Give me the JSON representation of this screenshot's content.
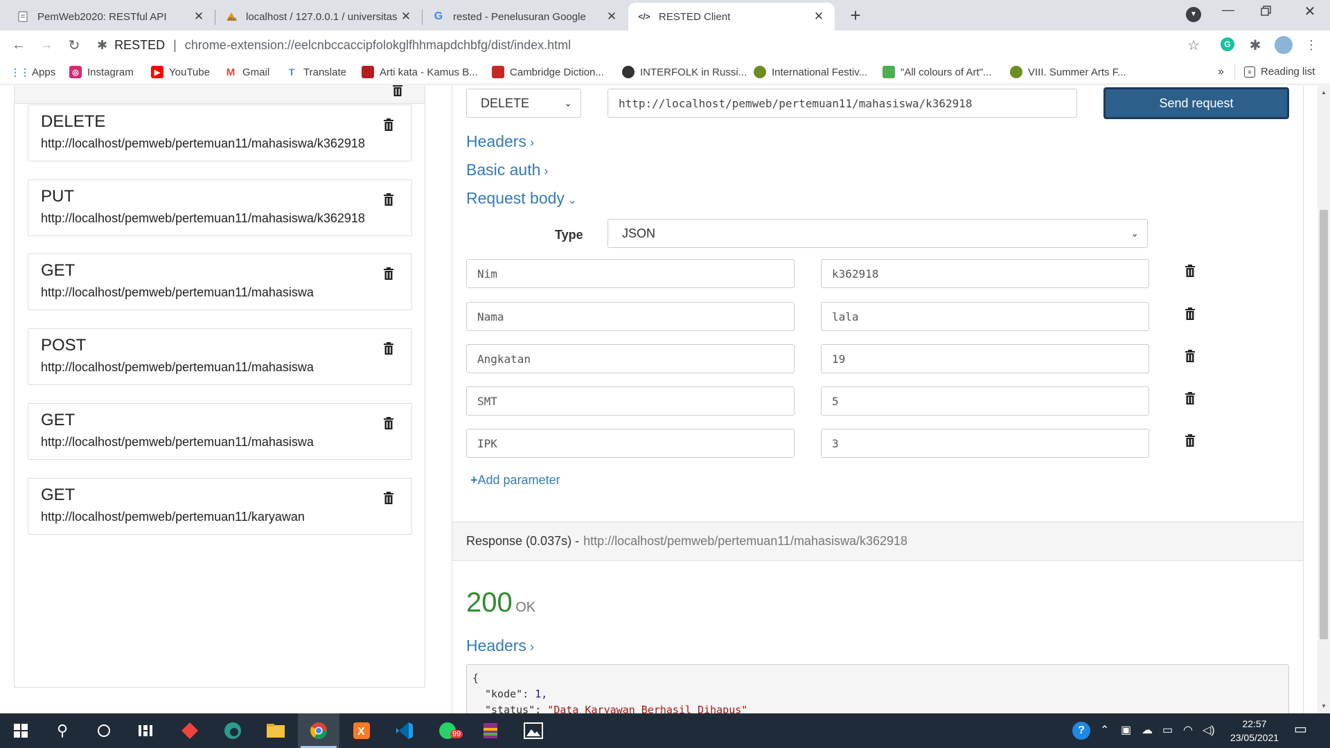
{
  "browser": {
    "tabs": [
      {
        "title": "PemWeb2020: RESTful API",
        "icon": "doc-icon"
      },
      {
        "title": "localhost / 127.0.0.1 / universitas",
        "icon": "phpmyadmin-icon"
      },
      {
        "title": "rested - Penelusuran Google",
        "icon": "google-icon"
      },
      {
        "title": "RESTED Client",
        "icon": "code-icon"
      }
    ],
    "new_tab": "+",
    "site_name": "RESTED",
    "address": "chrome-extension://eelcnbccaccipfolokglfhhmapdchbfg/dist/index.html",
    "bookmarks": [
      {
        "label": "Apps",
        "color": "#4285f4"
      },
      {
        "label": "Instagram",
        "color": "#d62976"
      },
      {
        "label": "YouTube",
        "color": "#ff0000"
      },
      {
        "label": "Gmail",
        "color": "#ea4335"
      },
      {
        "label": "Translate",
        "color": "#4285f4"
      },
      {
        "label": "Arti kata - Kamus B...",
        "color": "#b71c1c"
      },
      {
        "label": "Cambridge Diction...",
        "color": "#c62828"
      },
      {
        "label": "INTERFOLK in Russi...",
        "color": "#333333"
      },
      {
        "label": "International Festiv...",
        "color": "#6b8e23"
      },
      {
        "label": "\"All colours of Art\"...",
        "color": "#4caf50"
      },
      {
        "label": "VIII. Summer Arts F...",
        "color": "#6b8e23"
      }
    ],
    "more_bookmarks": "»",
    "reading_list": "Reading list"
  },
  "history": [
    {
      "method": "DELETE",
      "url": "http://localhost/pemweb/pertemuan11/mahasiswa/k362918"
    },
    {
      "method": "PUT",
      "url": "http://localhost/pemweb/pertemuan11/mahasiswa/k362918"
    },
    {
      "method": "GET",
      "url": "http://localhost/pemweb/pertemuan11/mahasiswa"
    },
    {
      "method": "POST",
      "url": "http://localhost/pemweb/pertemuan11/mahasiswa"
    },
    {
      "method": "GET",
      "url": "http://localhost/pemweb/pertemuan11/mahasiswa"
    },
    {
      "method": "GET",
      "url": "http://localhost/pemweb/pertemuan11/karyawan"
    }
  ],
  "request": {
    "method": "DELETE",
    "url": "http://localhost/pemweb/pertemuan11/mahasiswa/k362918",
    "send_label": "Send request",
    "headers_label": "Headers",
    "basic_auth_label": "Basic auth",
    "request_body_label": "Request body",
    "type_label": "Type",
    "type_value": "JSON",
    "params": [
      {
        "key": "Nim",
        "value": "k362918"
      },
      {
        "key": "Nama",
        "value": "lala"
      },
      {
        "key": "Angkatan",
        "value": "19"
      },
      {
        "key": "SMT",
        "value": "5"
      },
      {
        "key": "IPK",
        "value": "3"
      }
    ],
    "add_param_label": "Add parameter"
  },
  "response": {
    "title": "Response (0.037s) -",
    "url": "http://localhost/pemweb/pertemuan11/mahasiswa/k362918",
    "status_code": "200",
    "status_text": "OK",
    "headers_label": "Headers",
    "body_lines": [
      {
        "text": "{",
        "key": "",
        "sep": "",
        "val": ""
      },
      {
        "text": "",
        "key": "\"kode\"",
        "sep": ": ",
        "val": "1,"
      },
      {
        "text": "",
        "key": "\"status\"",
        "sep": ": ",
        "val": "\"Data Karyawan Berhasil Dihapus\""
      }
    ]
  },
  "taskbar": {
    "time": "22:57",
    "date": "23/05/2021",
    "whatsapp_badge": "99"
  }
}
